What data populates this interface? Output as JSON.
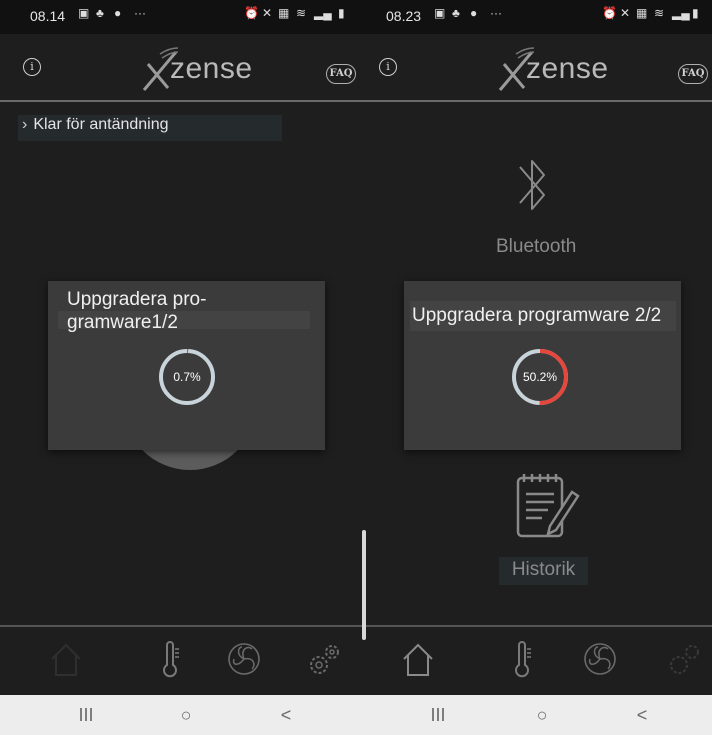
{
  "left": {
    "status_time": "08.14",
    "logo": "zense",
    "faq": "FAQ",
    "status_line": "Klar för antändning",
    "dialog": {
      "title_line1": "Uppgradera pro-",
      "title_line2": "gramware1/2",
      "progress_label": "0.7%",
      "progress": 0.007
    }
  },
  "right": {
    "status_time": "08.23",
    "logo": "zense",
    "faq": "FAQ",
    "bluetooth_label": "Bluetooth",
    "historik_label": "Historik",
    "dialog": {
      "title": "Uppgradera programware 2/2",
      "progress_label": "50.2%",
      "progress": 0.502
    }
  },
  "icons": [
    "info-icon",
    "faq-icon",
    "bluetooth-icon",
    "notepad-icon",
    "home-icon",
    "thermometer-icon",
    "fan-icon",
    "settings-gears-icon"
  ],
  "nav": {
    "recent": "III",
    "home": "○",
    "back": "<"
  },
  "colors": {
    "background": "#1e1e1e",
    "progress_accent": "#e5473c",
    "ring_track": "#c8d4d9"
  }
}
